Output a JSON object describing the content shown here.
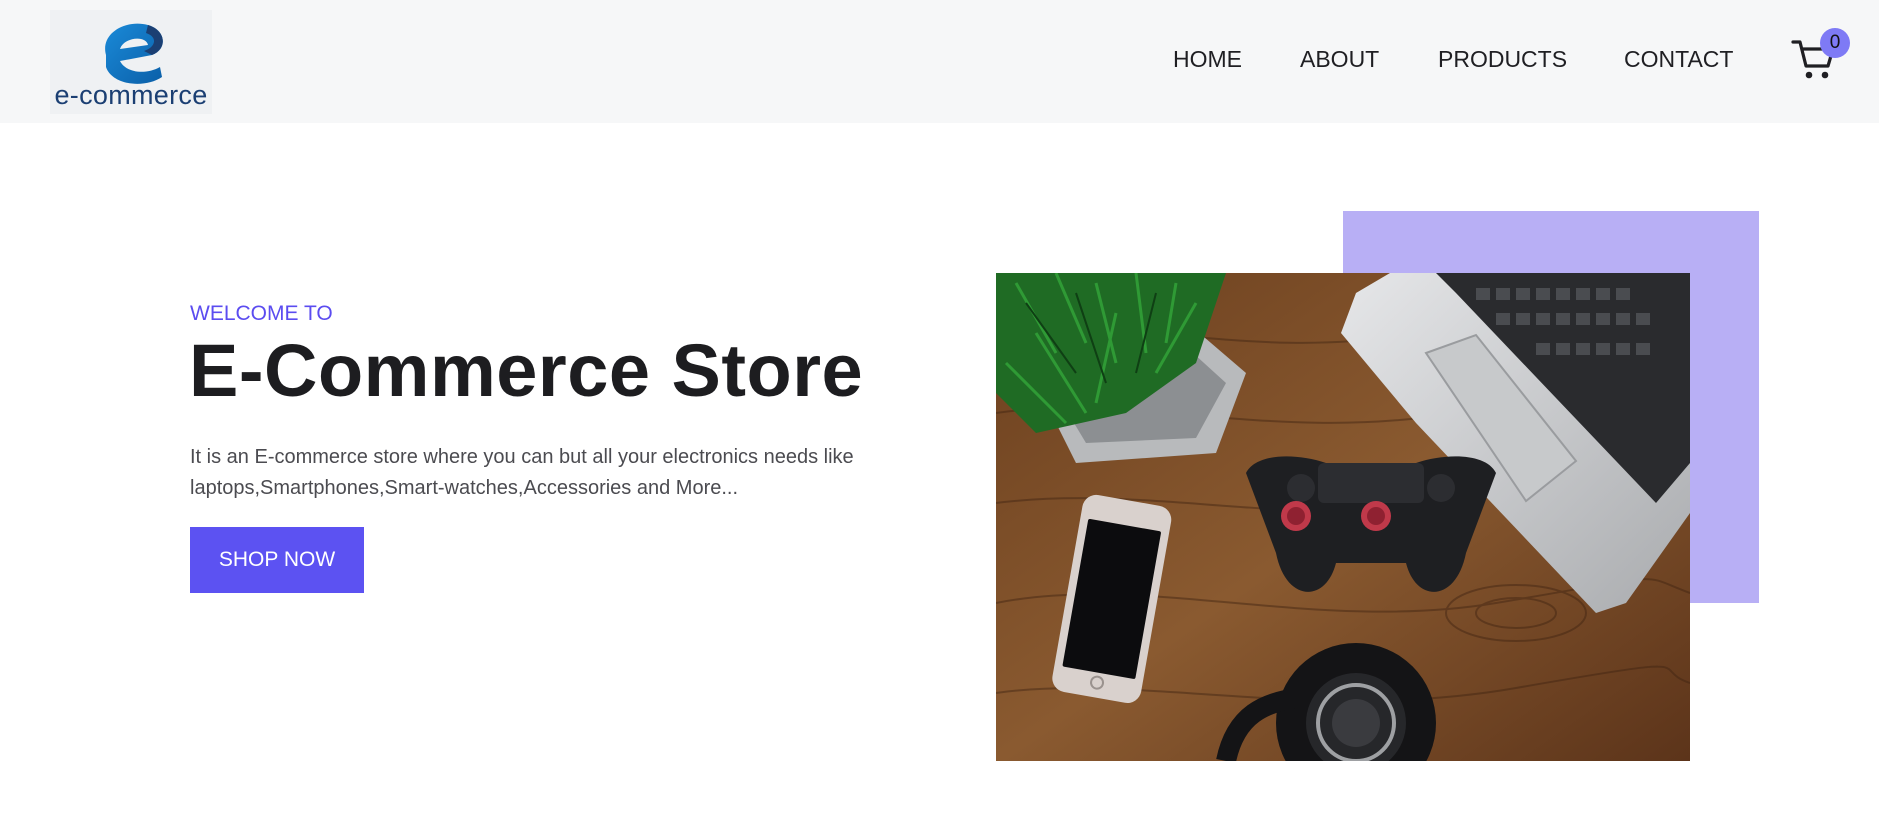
{
  "brand": {
    "logo_text": "e-commerce",
    "logo_icon": "e-logo-icon",
    "primary_color": "#1b3f73",
    "accent_color": "#1a73c8"
  },
  "nav": {
    "items": [
      {
        "label": "HOME"
      },
      {
        "label": "ABOUT"
      },
      {
        "label": "PRODUCTS"
      },
      {
        "label": "CONTACT"
      }
    ],
    "cart": {
      "icon": "cart-icon",
      "count": "0",
      "badge_color": "#7e7af5"
    }
  },
  "hero": {
    "eyebrow": "WELCOME TO",
    "title": "E-Commerce Store",
    "description": "It is an E-commerce store where you can but all your electronics needs like laptops,Smartphones,Smart-watches,Accessories and More...",
    "cta_label": "SHOP NOW",
    "accent_color": "#5c52f2",
    "decor_color": "#b8aff5",
    "image_subject": "wooden desk with laptop, game controller, smartphone, headphones and plant"
  }
}
